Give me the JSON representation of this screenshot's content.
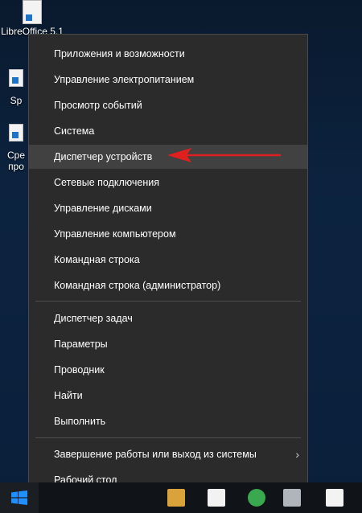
{
  "desktop": {
    "icons": [
      {
        "label": "LibreOffice 5.1",
        "icon": "libreoffice-doc-icon"
      },
      {
        "label": "Sp",
        "icon": "shortcut-icon"
      },
      {
        "label": "Сре про",
        "icon": "shortcut-icon"
      }
    ]
  },
  "menu": {
    "items": [
      {
        "label": "Приложения и возможности"
      },
      {
        "label": "Управление электропитанием"
      },
      {
        "label": "Просмотр событий"
      },
      {
        "label": "Система"
      },
      {
        "label": "Диспетчер устройств",
        "highlighted": true
      },
      {
        "label": "Сетевые подключения"
      },
      {
        "label": "Управление дисками"
      },
      {
        "label": "Управление компьютером"
      },
      {
        "label": "Командная строка"
      },
      {
        "label": "Командная строка (администратор)"
      },
      {
        "label": "Диспетчер задач"
      },
      {
        "label": "Параметры"
      },
      {
        "label": "Проводник"
      },
      {
        "label": "Найти"
      },
      {
        "label": "Выполнить"
      },
      {
        "label": "Завершение работы или выход из системы",
        "submenu": true
      },
      {
        "label": "Рабочий стол"
      }
    ]
  },
  "annotation": {
    "color": "#e0201f",
    "icon": "red-arrow-pointer"
  },
  "taskbar": {
    "start_icon": "windows-logo-icon",
    "accent": "#1e90ff"
  }
}
